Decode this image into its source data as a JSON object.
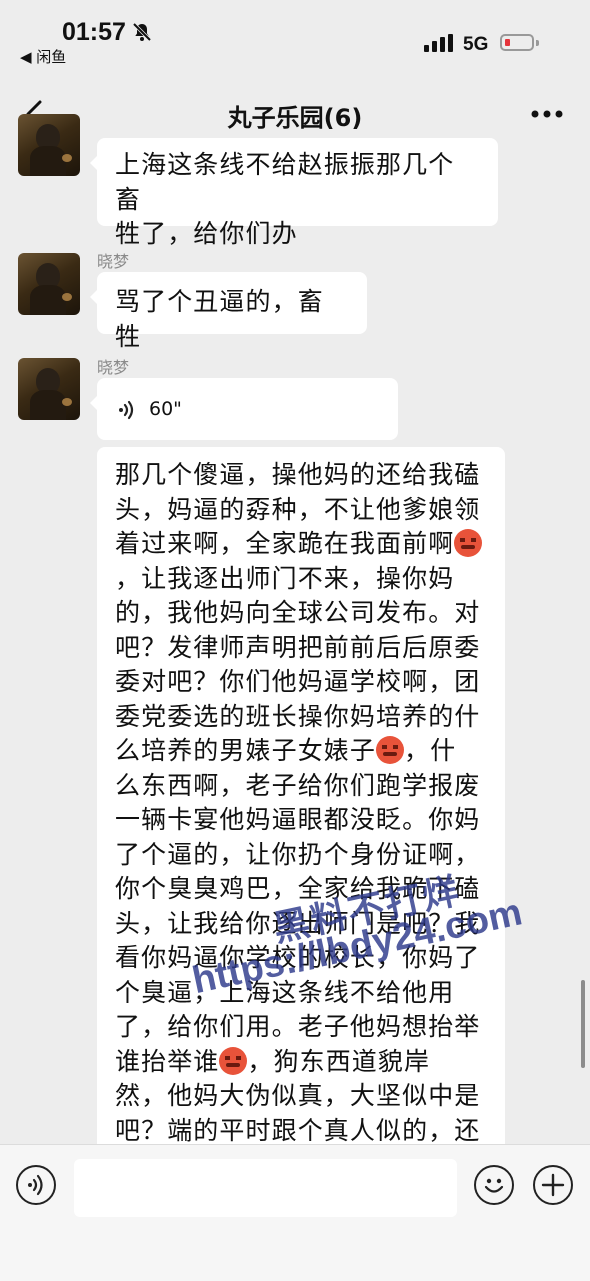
{
  "status_bar": {
    "time": "01:57",
    "back_app": "◀ 闲鱼",
    "network": "5G"
  },
  "nav": {
    "title": "丸子乐园(6)"
  },
  "messages": [
    {
      "text": "上海这条线不给赵振振那几个畜\n牲了，给你们办"
    },
    {
      "sender": "晓梦",
      "text": "骂了个丑逼的，畜牲"
    },
    {
      "sender": "晓梦",
      "voice_duration": "60\""
    },
    {
      "parts": [
        "那几个傻逼，操他妈的还给我磕\n头，妈逼的孬种，不让他爹娘领\n着过来啊，全家跪在我面前啊",
        "\n，让我逐出师门不来，操你妈\n的，我他妈向全球公司发布。对\n吧？发律师声明把前前后后原委\n委对吧？你们他妈逼学校啊，团\n委党委选的班长操你妈培养的什\n么培养的男婊子女婊子",
        "，什\n么东西啊，老子给你们跑学报废\n一辆卡宴他妈逼眼都没眨。你妈\n了个逼的，让你扔个身份证啊，\n你个臭臭鸡巴，全家给我跪下磕\n头，让我给你逐出师门是吧？我\n看你妈逼你学校的校长，你妈了\n个臭逼，上海这条线不给他用\n了，给你们用。老子他妈想抬举\n谁抬举谁",
        "，狗东西道貌岸\n然，他妈大伪似真，大坚似中是\n吧？端的平时跟个真人似的，还\n写他妈誓言计划计划，你妈了个"
      ]
    }
  ],
  "watermark": {
    "line1": "黑料不打烊",
    "line2": "https://lbdy24.com"
  },
  "icons": {
    "emoji": "angry-face-emoji"
  },
  "colors": {
    "background": "#ededed",
    "bubble": "#ffffff",
    "watermark": "#2e3a8c",
    "battery_low": "#e5343b"
  }
}
